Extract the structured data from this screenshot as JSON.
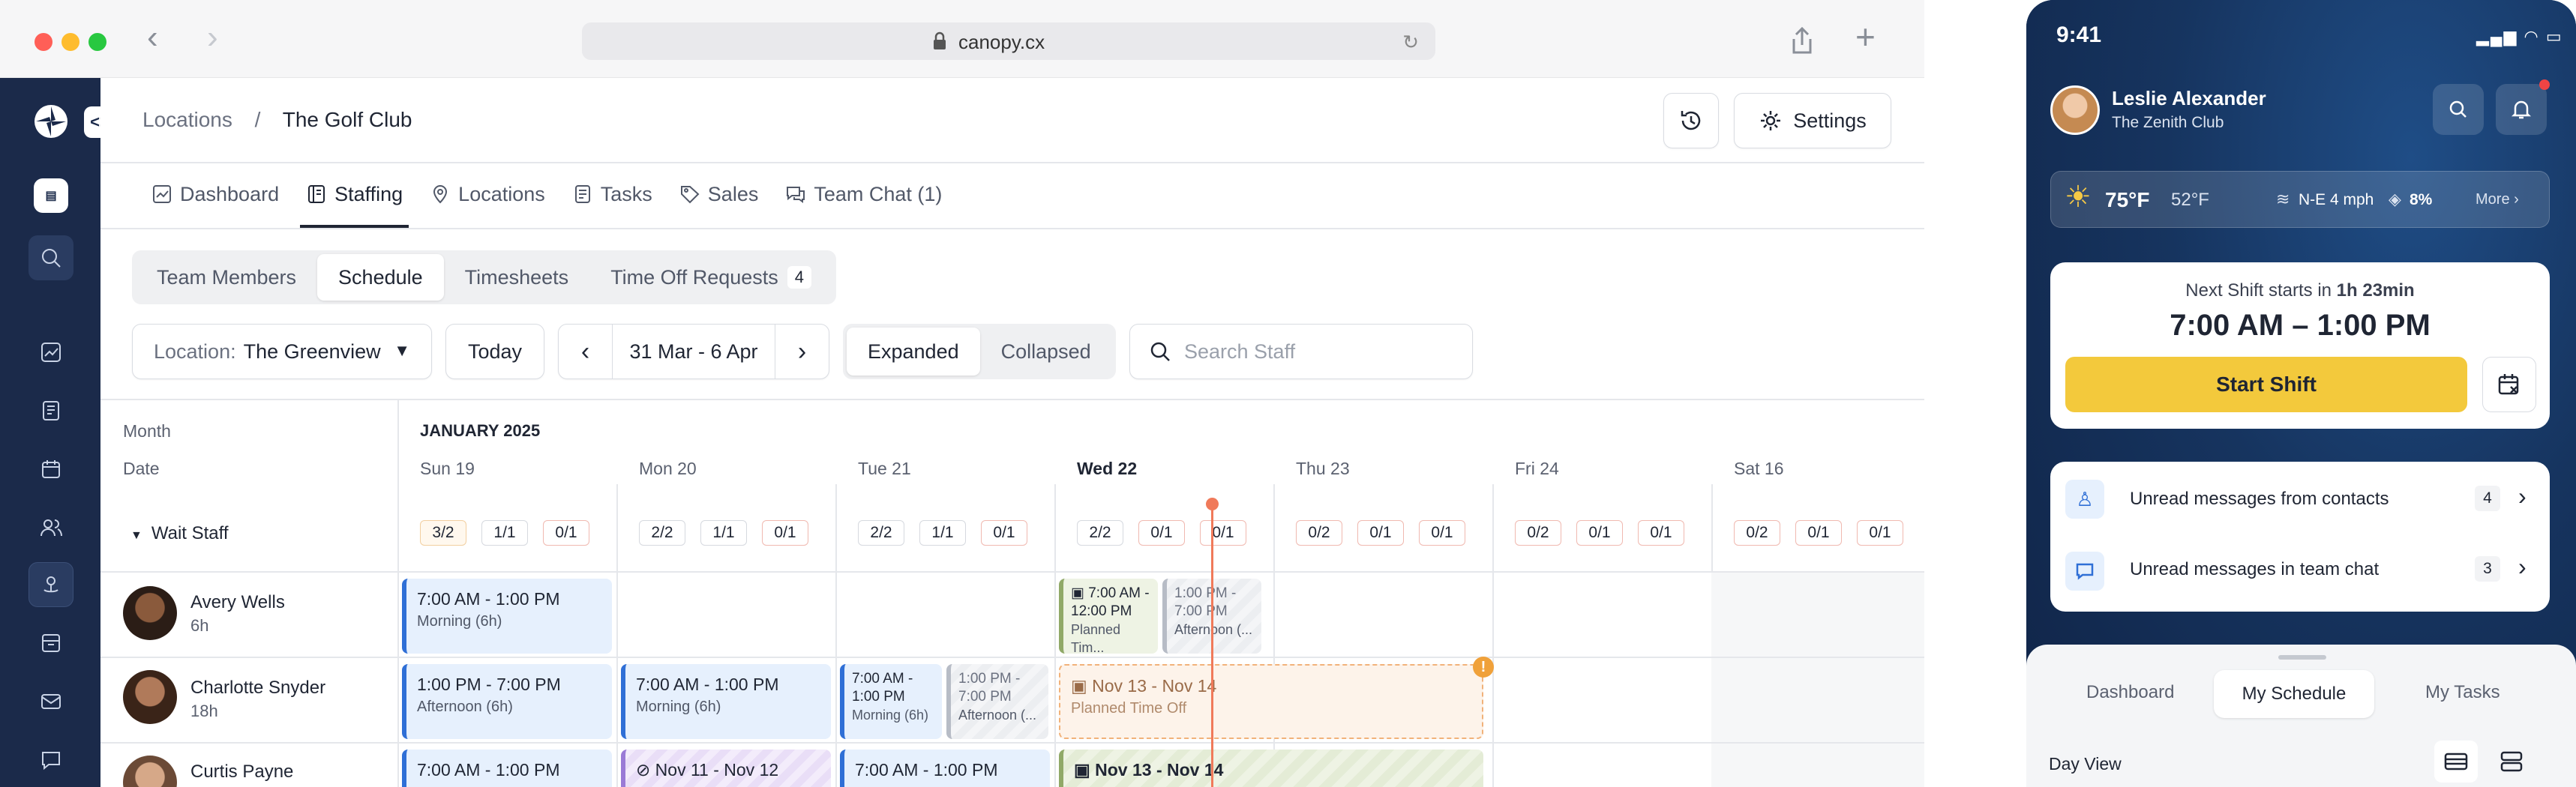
{
  "browser": {
    "url": "canopy.cx",
    "colors": {
      "close": "#ff5f57",
      "minimize": "#febc2e",
      "maximize": "#28c840"
    }
  },
  "header": {
    "breadcrumb_root": "Locations",
    "breadcrumb_sep": "/",
    "breadcrumb_current": "The Golf Club",
    "settings_label": "Settings"
  },
  "nav_tabs": [
    {
      "label": "Dashboard",
      "icon": "chart-icon"
    },
    {
      "label": "Staffing",
      "icon": "book-icon",
      "active": true
    },
    {
      "label": "Locations",
      "icon": "pin-icon"
    },
    {
      "label": "Tasks",
      "icon": "doc-icon"
    },
    {
      "label": "Sales",
      "icon": "tag-icon"
    },
    {
      "label": "Team Chat (1)",
      "icon": "chat-icon"
    }
  ],
  "sub_tabs": {
    "team_members": "Team Members",
    "schedule": "Schedule",
    "timesheets": "Timesheets",
    "time_off": "Time Off Requests",
    "time_off_count": "4"
  },
  "toolbar": {
    "location_label": "Location:",
    "location_value": "The Greenview",
    "today": "Today",
    "range": "31 Mar - 6 Apr",
    "expanded": "Expanded",
    "collapsed": "Collapsed",
    "search_placeholder": "Search Staff"
  },
  "grid": {
    "month_label": "Month",
    "date_label": "Date",
    "month_value": "JANUARY 2025",
    "days": [
      "Sun 19",
      "Mon 20",
      "Tue 21",
      "Wed 22",
      "Thu 23",
      "Fri 24",
      "Sat 16"
    ],
    "group": "Wait Staff",
    "counts": [
      [
        "3/2",
        "1/1",
        "0/1"
      ],
      [
        "2/2",
        "1/1",
        "0/1"
      ],
      [
        "2/2",
        "1/1",
        "0/1"
      ],
      [
        "2/2",
        "0/1",
        "0/1"
      ],
      [
        "0/2",
        "0/1",
        "0/1"
      ],
      [
        "0/2",
        "0/1",
        "0/1"
      ],
      [
        "0/2",
        "0/1",
        "0/1"
      ]
    ],
    "staff": [
      {
        "name": "Avery Wells",
        "hours": "6h"
      },
      {
        "name": "Charlotte Snyder",
        "hours": "18h"
      },
      {
        "name": "Curtis Payne",
        "hours": ""
      }
    ],
    "shifts": {
      "avery_sun": {
        "time": "7:00 AM - 1:00 PM",
        "sub": "Morning (6h)"
      },
      "avery_wed_a": {
        "time1": "7:00 AM -",
        "time2": "12:00 PM",
        "sub": "Planned Tim..."
      },
      "avery_wed_b": {
        "time1": "1:00 PM -",
        "time2": "7:00 PM",
        "sub": "Afternoon (..."
      },
      "charlotte_sun": {
        "time": "1:00 PM - 7:00 PM",
        "sub": "Afternoon (6h)"
      },
      "charlotte_mon": {
        "time": "7:00 AM - 1:00 PM",
        "sub": "Morning (6h)"
      },
      "charlotte_tue_a": {
        "time1": "7:00 AM -",
        "time2": "1:00 PM",
        "sub": "Morning (6h)"
      },
      "charlotte_tue_b": {
        "time1": "1:00 PM -",
        "time2": "7:00 PM",
        "sub": "Afternoon (..."
      },
      "charlotte_timeoff": {
        "time": "Nov 13 - Nov 14",
        "sub": "Planned Time Off"
      },
      "curtis_sun": {
        "time": "7:00 AM - 1:00 PM"
      },
      "curtis_mon": {
        "time": "Nov 11 - Nov 12"
      },
      "curtis_tue": {
        "time": "7:00 AM - 1:00 PM"
      },
      "curtis_wed": {
        "time": "Nov 13 - Nov 14"
      }
    }
  },
  "phone": {
    "time": "9:41",
    "user_name": "Leslie Alexander",
    "user_club": "The Zenith Club",
    "weather_temp": "75°F",
    "weather_low": "52°F",
    "wind": "N-E 4 mph",
    "humidity": "8%",
    "more": "More",
    "next_shift_prefix": "Next Shift starts in",
    "next_shift_in": "1h 23min",
    "shift_time": "7:00 AM – 1:00 PM",
    "start_shift": "Start Shift",
    "unread_contacts": "Unread messages from contacts",
    "unread_contacts_count": "4",
    "unread_chat": "Unread messages in team chat",
    "unread_chat_count": "3",
    "tabs": [
      "Dashboard",
      "My Schedule",
      "My Tasks"
    ],
    "day_view": "Day View",
    "accent": "#f3c93c"
  }
}
